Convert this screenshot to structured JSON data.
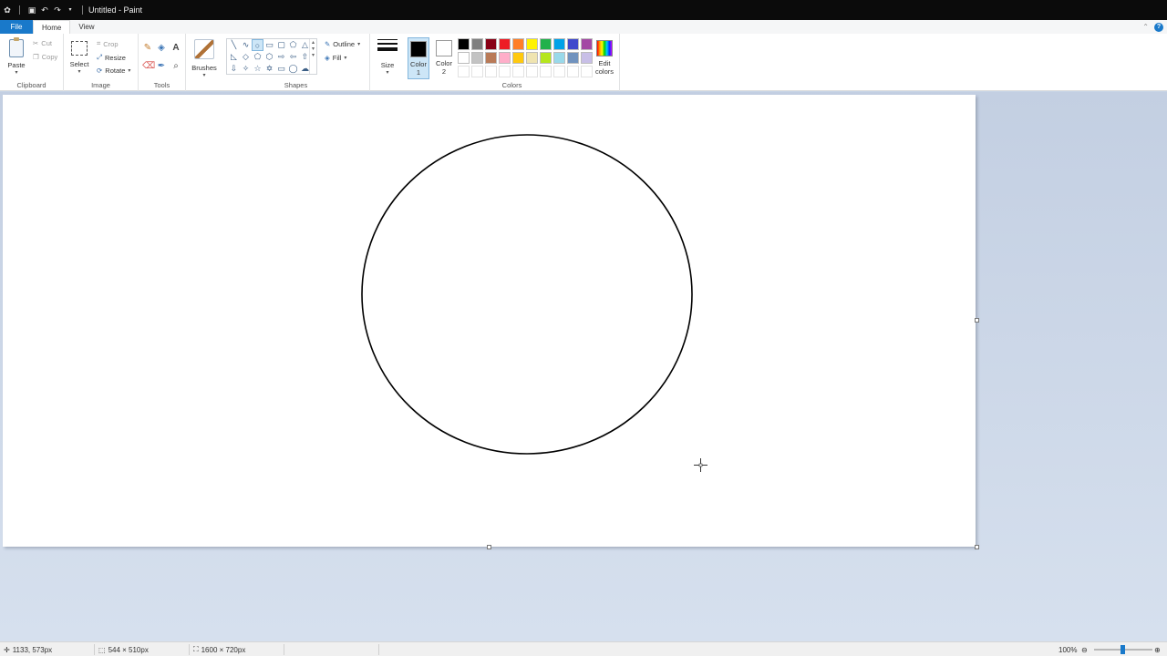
{
  "window": {
    "title": "Untitled - Paint"
  },
  "tabs": {
    "file": "File",
    "home": "Home",
    "view": "View"
  },
  "clipboard": {
    "label": "Clipboard",
    "paste": "Paste",
    "cut": "Cut",
    "copy": "Copy"
  },
  "image": {
    "label": "Image",
    "select": "Select",
    "crop": "Crop",
    "resize": "Resize",
    "rotate": "Rotate"
  },
  "tools": {
    "label": "Tools",
    "text_glyph": "A"
  },
  "brushes": {
    "label": "Brushes"
  },
  "shapes": {
    "label": "Shapes",
    "outline": "Outline",
    "fill": "Fill"
  },
  "size": {
    "label": "Size"
  },
  "colors": {
    "label": "Colors",
    "color1_line1": "Color",
    "color1_line2": "1",
    "color2_line1": "Color",
    "color2_line2": "2",
    "edit_line1": "Edit",
    "edit_line2": "colors",
    "color1_value": "#000000",
    "color2_value": "#ffffff",
    "palette": [
      "#000000",
      "#7f7f7f",
      "#880015",
      "#ed1c24",
      "#ff7f27",
      "#fff200",
      "#22b14c",
      "#00a2e8",
      "#3f48cc",
      "#a349a4",
      "#ffffff",
      "#c3c3c3",
      "#b97a57",
      "#ffaec9",
      "#ffc90e",
      "#efe4b0",
      "#b5e61d",
      "#99d9ea",
      "#7092be",
      "#c8bfe7",
      "#ffffff",
      "#ffffff",
      "#ffffff",
      "#ffffff",
      "#ffffff",
      "#ffffff",
      "#ffffff",
      "#ffffff",
      "#ffffff",
      "#ffffff"
    ]
  },
  "status": {
    "cursor_pos": "1133, 573px",
    "selection_size": "544 × 510px",
    "image_size": "1600 × 720px",
    "zoom": "100%"
  }
}
